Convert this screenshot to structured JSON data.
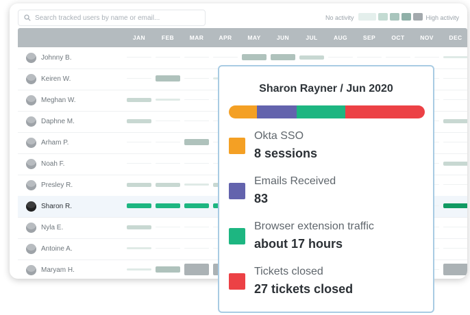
{
  "search": {
    "placeholder": "Search tracked users by name or email..."
  },
  "legend": {
    "low_label": "No activity",
    "high_label": "High activity",
    "colors": [
      "#e4efec",
      "#c3dbd2",
      "#a9c5bd",
      "#8fb0a8",
      "#a3a9ad"
    ]
  },
  "months": [
    "JAN",
    "FEB",
    "MAR",
    "APR",
    "MAY",
    "JUN",
    "JUL",
    "AUG",
    "SEP",
    "OCT",
    "NOV",
    "DEC"
  ],
  "users": [
    {
      "name": "Johnny B.",
      "levels": [
        0,
        0,
        0,
        0,
        3,
        3,
        2,
        0,
        0,
        0,
        0,
        1
      ]
    },
    {
      "name": "Keiren W.",
      "levels": [
        0,
        3,
        0,
        1,
        0,
        0,
        0,
        0,
        0,
        0,
        0,
        0
      ]
    },
    {
      "name": "Meghan W.",
      "levels": [
        2,
        1,
        0,
        0,
        0,
        0,
        0,
        0,
        0,
        0,
        0,
        0
      ]
    },
    {
      "name": "Daphne M.",
      "levels": [
        2,
        0,
        0,
        0,
        0,
        0,
        0,
        0,
        0,
        0,
        0,
        2
      ]
    },
    {
      "name": "Arham P.",
      "levels": [
        0,
        0,
        3,
        0,
        0,
        0,
        0,
        0,
        0,
        0,
        0,
        0
      ]
    },
    {
      "name": "Noah F.",
      "levels": [
        0,
        0,
        0,
        0,
        0,
        0,
        0,
        0,
        0,
        0,
        0,
        2
      ]
    },
    {
      "name": "Presley R.",
      "levels": [
        2,
        2,
        1,
        2,
        0,
        0,
        0,
        0,
        0,
        0,
        0,
        0
      ]
    },
    {
      "name": "Sharon R.",
      "levels": [
        5,
        5,
        5,
        5,
        0,
        0,
        0,
        0,
        0,
        0,
        0,
        5
      ],
      "selected": true
    },
    {
      "name": "Nyla E.",
      "levels": [
        2,
        0,
        0,
        0,
        0,
        0,
        0,
        0,
        0,
        0,
        0,
        0
      ]
    },
    {
      "name": "Antoine A.",
      "levels": [
        1,
        0,
        0,
        0,
        0,
        0,
        0,
        0,
        0,
        0,
        0,
        0
      ]
    },
    {
      "name": "Maryam H.",
      "levels": [
        1,
        3,
        4,
        4,
        0,
        0,
        0,
        0,
        0,
        0,
        0,
        4
      ]
    }
  ],
  "tooltip": {
    "title": "Sharon Rayner / Jun 2020",
    "metrics": [
      {
        "label": "Okta SSO",
        "value": "8 sessions",
        "color": "#f4a024",
        "share": 0.145
      },
      {
        "label": "Emails Received",
        "value": "83",
        "color": "#6363ad",
        "share": 0.2
      },
      {
        "label": "Browser extension traffic",
        "value": "about 17 hours",
        "color": "#1db681",
        "share": 0.25
      },
      {
        "label": "Tickets closed",
        "value": "27 tickets closed",
        "color": "#ec4145",
        "share": 0.405
      }
    ]
  }
}
